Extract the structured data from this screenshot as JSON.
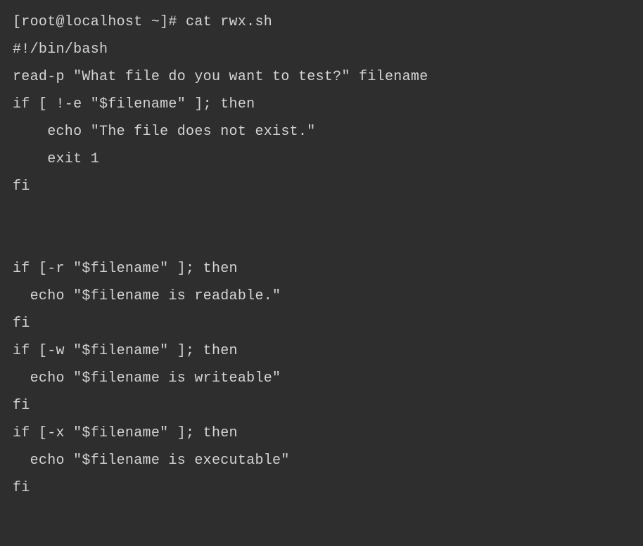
{
  "terminal": {
    "prompt": "[root@localhost ~]# ",
    "command": "cat rwx.sh",
    "lines": [
      "#!/bin/bash",
      "read-p \"What file do you want to test?\" filename",
      "if [ !-e \"$filename\" ]; then",
      "    echo \"The file does not exist.\"",
      "    exit 1",
      "fi",
      "",
      "",
      "if [-r \"$filename\" ]; then",
      "  echo \"$filename is readable.\"",
      "fi",
      "if [-w \"$filename\" ]; then",
      "  echo \"$filename is writeable\"",
      "fi",
      "if [-x \"$filename\" ]; then",
      "  echo \"$filename is executable\"",
      "fi"
    ]
  }
}
